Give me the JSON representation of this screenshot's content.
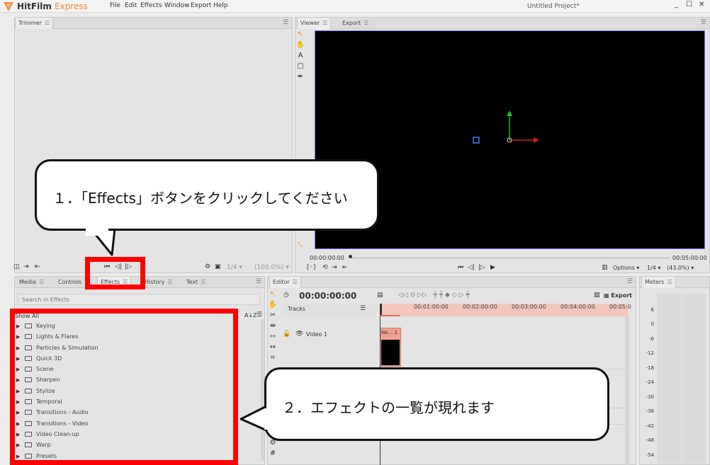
{
  "app": {
    "name": "HitFilm",
    "edition": "Express",
    "project_title": "Untitled Project*",
    "menu": [
      "File",
      "Edit",
      "Effects",
      "Window",
      "Export",
      "Help"
    ],
    "window_controls": [
      "_",
      "☐",
      "✕"
    ]
  },
  "trimmer": {
    "tab": "Trimmer",
    "zoom": "1/4",
    "percent": "(100.0%)"
  },
  "viewer": {
    "tabs": [
      "Viewer",
      "Export"
    ],
    "timecode_start": "00:00:00:00",
    "timecode_end": "00:05:00:00",
    "options_label": "Options",
    "zoom": "1/4",
    "percent": "(43.0%)"
  },
  "media_panel": {
    "tabs": [
      "Media",
      "Controls",
      "Effects",
      "History",
      "Text"
    ],
    "search_placeholder": "Search in Effects",
    "filter_label": "Show All",
    "sort_label": "A↓Z",
    "categories": [
      "Keying",
      "Lights & Flares",
      "Particles & Simulation",
      "Quick 3D",
      "Scene",
      "Sharpen",
      "Stylize",
      "Temporal",
      "Transitions - Audio",
      "Transitions - Video",
      "Video Clean-up",
      "Warp",
      "Presets"
    ]
  },
  "editor": {
    "tab": "Editor",
    "timecode": "00:00:00:00",
    "export_label": "Export",
    "tracks_label": "Tracks",
    "track_name": "Video 1",
    "clip_label": "Ne... 1",
    "ruler": [
      "00:01:00:00",
      "00:02:00:00",
      "00:03:00:00",
      "00:04:00:00",
      "00:05:0"
    ]
  },
  "meters": {
    "tab": "Meters",
    "scale": [
      "6",
      "0",
      "-6",
      "-12",
      "-18",
      "-24",
      "-30",
      "-36",
      "-42",
      "-48",
      "-54"
    ]
  },
  "annotations": {
    "step1": "１．「Effects」ボタンをクリックしてください",
    "step2": "２．エフェクトの一覧が現れます"
  },
  "colors": {
    "accent": "#f08a3c",
    "highlight_red": "#ff0000",
    "viewer_border": "#6d6df0",
    "clip": "#f0a090"
  }
}
